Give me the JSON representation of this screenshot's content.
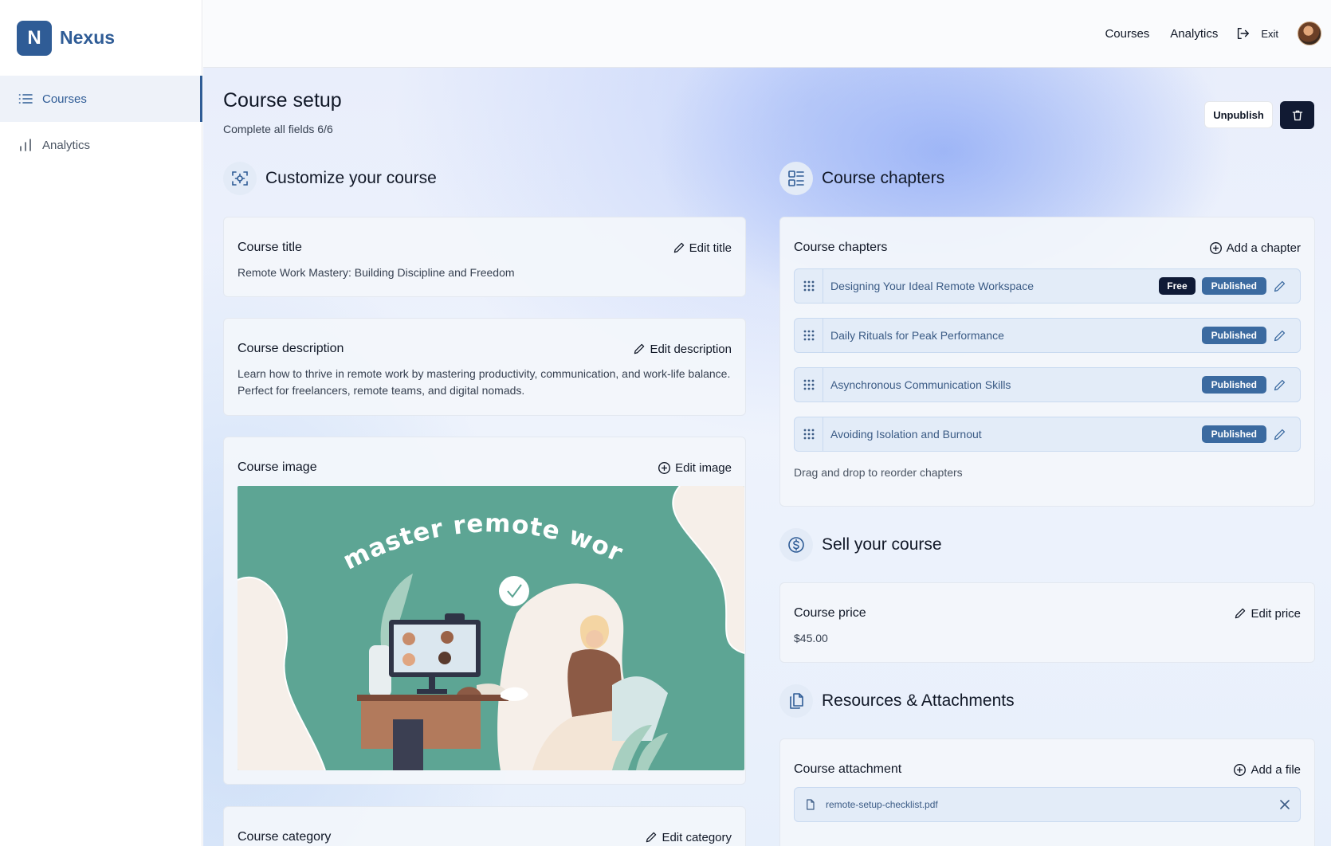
{
  "brand": {
    "logo_letter": "N",
    "name": "Nexus"
  },
  "sidebar": {
    "items": [
      {
        "label": "Courses",
        "icon": "list-icon",
        "active": true
      },
      {
        "label": "Analytics",
        "icon": "bar-chart-icon",
        "active": false
      }
    ]
  },
  "topbar": {
    "courses": "Courses",
    "analytics": "Analytics",
    "exit": "Exit"
  },
  "page": {
    "title": "Course setup",
    "subtitle": "Complete all fields 6/6",
    "unpublish": "Unpublish"
  },
  "customize": {
    "heading": "Customize your course",
    "title_card": {
      "title": "Course title",
      "action": "Edit title",
      "value": "Remote Work Mastery: Building Discipline and Freedom"
    },
    "description_card": {
      "title": "Course description",
      "action": "Edit description",
      "value": "Learn how to thrive in remote work by mastering productivity, communication, and work-life balance. Perfect for freelancers, remote teams, and digital nomads."
    },
    "image_card": {
      "title": "Course image",
      "action": "Edit image",
      "image_text": "master remote work"
    },
    "category_card": {
      "title": "Course category",
      "action": "Edit category"
    }
  },
  "chapters": {
    "heading": "Course chapters",
    "card_title": "Course chapters",
    "action": "Add a chapter",
    "items": [
      {
        "name": "Designing Your Ideal Remote Workspace",
        "free": "Free",
        "status": "Published"
      },
      {
        "name": "Daily Rituals for Peak Performance",
        "status": "Published"
      },
      {
        "name": "Asynchronous Communication Skills",
        "status": "Published"
      },
      {
        "name": "Avoiding Isolation and Burnout",
        "status": "Published"
      }
    ],
    "hint": "Drag and drop to reorder chapters"
  },
  "sell": {
    "heading": "Sell your course",
    "price_card": {
      "title": "Course price",
      "action": "Edit price",
      "value": "$45.00"
    }
  },
  "resources": {
    "heading": "Resources & Attachments",
    "card": {
      "title": "Course attachment",
      "action": "Add a file",
      "files": [
        "remote-setup-checklist.pdf"
      ]
    }
  },
  "colors": {
    "brand": "#2f5c96",
    "dark": "#0f1a36",
    "published": "#3b6aa0"
  }
}
